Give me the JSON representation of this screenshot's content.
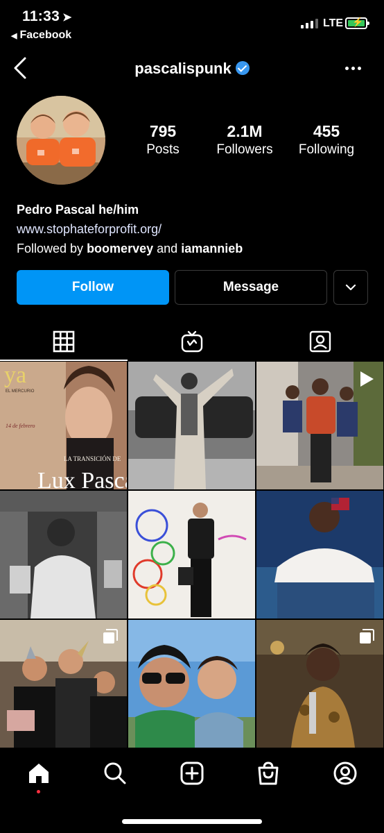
{
  "status_bar": {
    "time": "11:33",
    "network": "LTE",
    "back_app": "Facebook"
  },
  "header": {
    "username": "pascalispunk"
  },
  "profile": {
    "stats": [
      {
        "value": "795",
        "label": "Posts"
      },
      {
        "value": "2.1M",
        "label": "Followers"
      },
      {
        "value": "455",
        "label": "Following"
      }
    ],
    "name": "Pedro Pascal he/him",
    "website": "www.stophateforprofit.org/",
    "followed_prefix": "Followed by",
    "followed_user1": "boomervey",
    "followed_and": "and",
    "followed_user2": "iamannieb"
  },
  "actions": {
    "follow": "Follow",
    "message": "Message"
  },
  "magazine": {
    "masthead": "ya",
    "subhead": "EL MERCURIO",
    "headline": "LA TRANSICIÓN DE",
    "cover_name": "Lux Pascal",
    "date": "14 de febrero"
  },
  "colors": {
    "accent": "#0095f6",
    "verified": "#3897f0",
    "notification": "#ff3040"
  }
}
